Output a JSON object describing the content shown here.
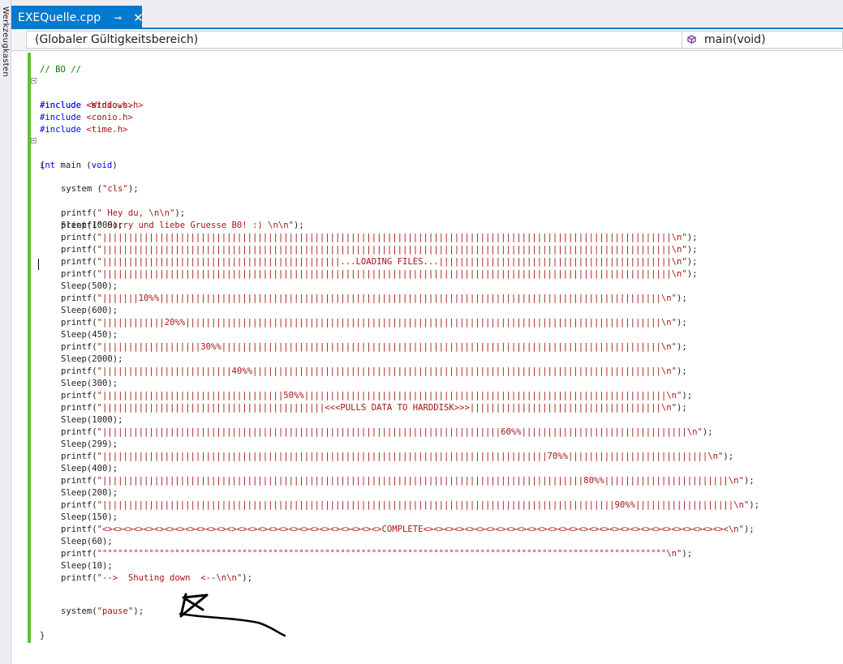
{
  "sidebar": {
    "vertical_label": "Werkzeugkasten"
  },
  "tab": {
    "title": "EXEQuelle.cpp",
    "pin_icon": "pin-icon",
    "close_icon": "close-icon"
  },
  "nav": {
    "scope": "(Globaler Gültigkeitsbereich)",
    "function": "main(void)"
  },
  "code": {
    "comment": "// BO //",
    "include_kw": "#include",
    "includes": [
      "<Windows.h>",
      "<stdio.h>",
      "<conio.h>",
      "<time.h>"
    ],
    "main_kw": "int",
    "main_name": " main (",
    "main_param": "void",
    "main_close": ")",
    "open_brace": "{",
    "close_brace": "}",
    "system_cls_pre": "system (",
    "system_cls_str": "\"cls\"",
    "system_cls_post": ");",
    "hey_pre": "printf(",
    "hey_str": "\" Hey du, \\n\\n\"",
    "hey_post": ");",
    "sorry_pre": "printf(",
    "sorry_str": "\" Sorry und liebe Gruesse B0! :) \\n\\n\"",
    "sorry_post": ");",
    "body": [
      {
        "t": "sleep",
        "v": "Sleep(1000);"
      },
      {
        "t": "printf",
        "s": "\"||||||||||||||||||||||||||||||||||||||||||||||||||||||||||||||||||||||||||||||||||||||||||||||||||||||||||||||\\n\""
      },
      {
        "t": "printf",
        "s": "\"||||||||||||||||||||||||||||||||||||||||||||||||||||||||||||||||||||||||||||||||||||||||||||||||||||||||||||||\\n\""
      },
      {
        "t": "printf",
        "s": "\"||||||||||||||||||||||||||||||||||||||||||||||...LOADING FILES...|||||||||||||||||||||||||||||||||||||||||||||\\n\""
      },
      {
        "t": "printf",
        "s": "\"||||||||||||||||||||||||||||||||||||||||||||||||||||||||||||||||||||||||||||||||||||||||||||||||||||||||||||||\\n\""
      },
      {
        "t": "sleep",
        "v": "Sleep(500);"
      },
      {
        "t": "printf",
        "s": "\"|||||||10%%|||||||||||||||||||||||||||||||||||||||||||||||||||||||||||||||||||||||||||||||||||||||||||||||||\\n\""
      },
      {
        "t": "sleep",
        "v": "Sleep(600);"
      },
      {
        "t": "printf",
        "s": "\"||||||||||||20%%||||||||||||||||||||||||||||||||||||||||||||||||||||||||||||||||||||||||||||||||||||||||||||\\n\""
      },
      {
        "t": "sleep",
        "v": "Sleep(450);"
      },
      {
        "t": "printf",
        "s": "\"|||||||||||||||||||30%%|||||||||||||||||||||||||||||||||||||||||||||||||||||||||||||||||||||||||||||||||||||\\n\""
      },
      {
        "t": "sleep",
        "v": "Sleep(2000);"
      },
      {
        "t": "printf",
        "s": "\"|||||||||||||||||||||||||40%%|||||||||||||||||||||||||||||||||||||||||||||||||||||||||||||||||||||||||||||||\\n\""
      },
      {
        "t": "sleep",
        "v": "Sleep(300);"
      },
      {
        "t": "printf",
        "s": "\"|||||||||||||||||||||||||||||||||||50%%||||||||||||||||||||||||||||||||||||||||||||||||||||||||||||||||||||||\\n\""
      },
      {
        "t": "printf",
        "s": "\"|||||||||||||||||||||||||||||||||||||||||||<<<PULLS DATA TO HARDDISK>>>|||||||||||||||||||||||||||||||||||||\\n\""
      },
      {
        "t": "sleep",
        "v": "Sleep(1000);"
      },
      {
        "t": "printf",
        "s": "\"|||||||||||||||||||||||||||||||||||||||||||||||||||||||||||||||||||||||||||||60%%||||||||||||||||||||||||||||||||\\n\""
      },
      {
        "t": "sleep",
        "v": "Sleep(299);"
      },
      {
        "t": "printf",
        "s": "\"||||||||||||||||||||||||||||||||||||||||||||||||||||||||||||||||||||||||||||||||||||||70%%|||||||||||||||||||||||||||\\n\""
      },
      {
        "t": "sleep",
        "v": "Sleep(400);"
      },
      {
        "t": "printf",
        "s": "\"|||||||||||||||||||||||||||||||||||||||||||||||||||||||||||||||||||||||||||||||||||||||||||||80%%||||||||||||||||||||||||\\n\""
      },
      {
        "t": "sleep",
        "v": "Sleep(200);"
      },
      {
        "t": "printf",
        "s": "\"|||||||||||||||||||||||||||||||||||||||||||||||||||||||||||||||||||||||||||||||||||||||||||||||||||90%%|||||||||||||||||||\\n\""
      },
      {
        "t": "sleep",
        "v": "Sleep(150);"
      },
      {
        "t": "printf",
        "s": "\"<><><><><><><><><><><><><><><><><><><><><><><><><><><>COMPLETE<><><><><><><><><><><><><><><><><><><><><><><><><><><><><><\\n\""
      },
      {
        "t": "sleep",
        "v": "Sleep(60);"
      },
      {
        "t": "printf",
        "s": "\"°°°°°°°°°°°°°°°°°°°°°°°°°°°°°°°°°°°°°°°°°°°°°°°°°°°°°°°°°°°°°°°°°°°°°°°°°°°°°°°°°°°°°°°°°°°°°°°°°°°°°°°°°°°°°\\n\""
      },
      {
        "t": "sleep",
        "v": "Sleep(10);"
      },
      {
        "t": "printf",
        "s": "\"-->  Shuting down  <--\\n\\n\""
      }
    ],
    "printf_pre": "printf(",
    "printf_post": ");",
    "pause_pre": "system(",
    "pause_str": "\"pause\"",
    "pause_post": ");"
  }
}
